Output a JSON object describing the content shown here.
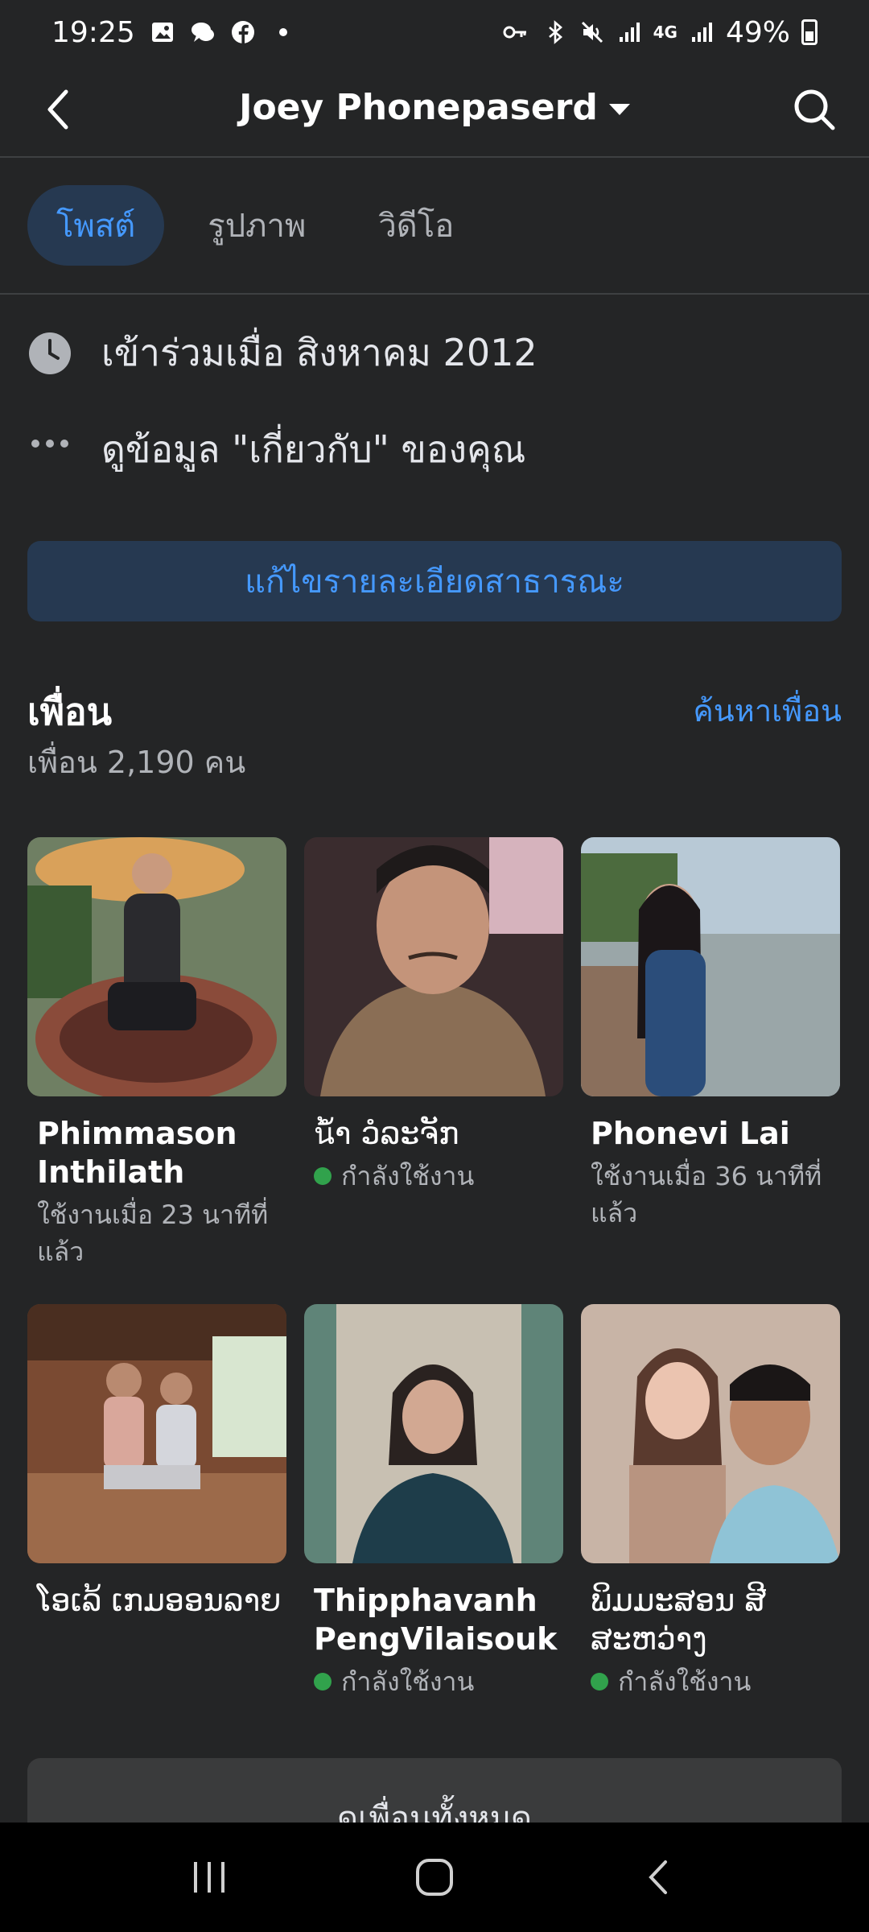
{
  "status_bar": {
    "time": "19:25",
    "battery": "49%",
    "network": "4G"
  },
  "header": {
    "title": "Joey Phonepaserd"
  },
  "tabs": [
    {
      "label": "โพสต์",
      "active": true
    },
    {
      "label": "รูปภาพ",
      "active": false
    },
    {
      "label": "วิดีโอ",
      "active": false
    }
  ],
  "info": {
    "joined": "เข้าร่วมเมื่อ สิงหาคม 2012",
    "about": "ดูข้อมูล \"เกี่ยวกับ\" ของคุณ"
  },
  "edit_button": "แก้ไขรายละเอียดสาธารณะ",
  "friends": {
    "title": "เพื่อน",
    "find_link": "ค้นหาเพื่อน",
    "count": "เพื่อน 2,190 คน",
    "items": [
      {
        "name": "Phimmason Inthilath",
        "status": "ใช้งานเมื่อ 23 นาทีที่แล้ว",
        "online": false
      },
      {
        "name": "น້ຳ ວໍລະຈັກ",
        "status": "กำลังใช้งาน",
        "online": true
      },
      {
        "name": "Phonevi Lai",
        "status": "ใช้งานเมื่อ 36 นาทีที่แล้ว",
        "online": false
      },
      {
        "name": "ໂອເລ້ ເກມອອນລາຍ",
        "status": "",
        "online": false
      },
      {
        "name": "Thipphavanh PengVilaisouk",
        "status": "กำลังใช้งาน",
        "online": true
      },
      {
        "name": "ພິມມະສອນ ສີສະຫວ່າງ",
        "status": "กำลังใช้งาน",
        "online": true
      }
    ],
    "see_all": "ดูเพื่อนทั้งหมด"
  },
  "colors": {
    "background": "#242526",
    "accent": "#4599ff",
    "accent_bg": "#263951",
    "online": "#31a24c"
  }
}
